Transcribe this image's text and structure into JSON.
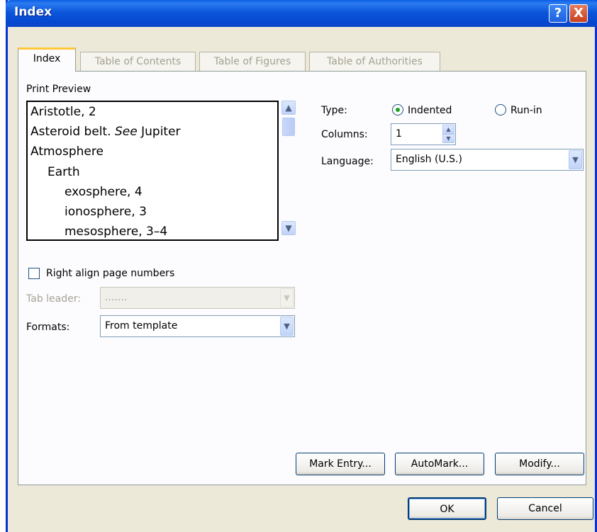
{
  "window": {
    "title": "Index",
    "help_glyph": "?",
    "close_glyph": "X"
  },
  "tabs": [
    {
      "label": "Index",
      "active": true
    },
    {
      "label": "Table of Contents",
      "active": false
    },
    {
      "label": "Table of Figures",
      "active": false
    },
    {
      "label": "Table of Authorities",
      "active": false
    }
  ],
  "print_preview": {
    "label": "Print Preview",
    "lines": [
      "Aristotle, 2",
      "Asteroid belt.",
      "See",
      "Jupiter",
      "Atmosphere",
      "Earth",
      "exosphere, 4",
      "ionosphere, 3",
      "mesosphere, 3–4"
    ]
  },
  "type": {
    "label": "Type:",
    "options": [
      "Indented",
      "Run-in"
    ],
    "selected": "Indented"
  },
  "columns": {
    "label": "Columns:",
    "value": "1"
  },
  "language": {
    "label": "Language:",
    "value": "English (U.S.)"
  },
  "right_align": {
    "label": "Right align page numbers",
    "checked": false
  },
  "tab_leader": {
    "label": "Tab leader:",
    "value": ".......",
    "disabled": true
  },
  "formats": {
    "label": "Formats:",
    "value": "From template"
  },
  "buttons": {
    "mark_entry": "Mark Entry...",
    "automark": "AutoMark...",
    "modify": "Modify...",
    "ok": "OK",
    "cancel": "Cancel"
  },
  "colors": {
    "title_bar": "#0A5EE7",
    "dialog_bg": "#ECE9D8",
    "active_tab_accent": "#FFC83C",
    "radio_dot": "#21A121"
  },
  "icons": {
    "scroll_up": "chevron-up-icon",
    "scroll_down": "chevron-down-icon",
    "dropdown": "chevron-down-icon"
  }
}
